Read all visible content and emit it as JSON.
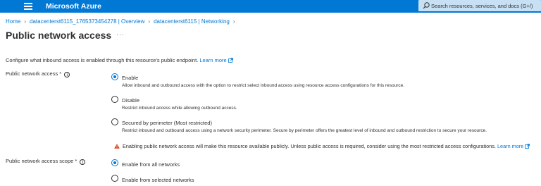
{
  "header": {
    "brand": "Microsoft Azure",
    "search_placeholder": "Search resources, services, and docs (G+/)"
  },
  "breadcrumb": [
    "Home",
    "datacenterst6115_1765373454278 | Overview",
    "datacenterst6115 | Networking"
  ],
  "page": {
    "title": "Public network access",
    "more": "···"
  },
  "intro": {
    "text": "Configure what inbound access is enabled through this resource's public endpoint.",
    "link": "Learn more"
  },
  "access": {
    "label": "Public network access *",
    "options": [
      {
        "title": "Enable",
        "description": "Allow inbound and outbound access with the option to restrict select inbound access using resource access configurations for this resource.",
        "selected": true
      },
      {
        "title": "Disable",
        "description": "Restrict inbound access while allowing outbound access.",
        "selected": false
      },
      {
        "title": "Secured by perimeter (Most restricted)",
        "description": "Restrict inbound and outbound access using a network security perimeter. Secure by perimeter offers the greatest level of inbound and outbound restriction to secure your resource.",
        "selected": false
      }
    ],
    "warning": "Enabling public network access will make this resource available publicly. Unless public access is required, consider using the most restricted access configurations.",
    "warning_link": "Learn more"
  },
  "scope": {
    "label": "Public network access scope *",
    "options": [
      {
        "title": "Enable from all networks",
        "selected": true
      },
      {
        "title": "Enable from selected networks",
        "selected": false
      }
    ]
  },
  "colors": {
    "topbar": "#0078d4",
    "search_bg": "#c7e0f4",
    "link": "#0078d4",
    "warning": "#d83b01",
    "text": "#323130"
  }
}
